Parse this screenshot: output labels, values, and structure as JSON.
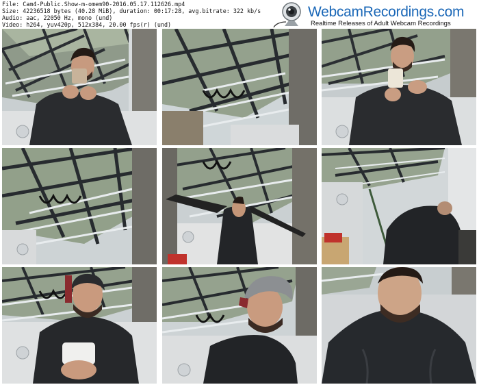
{
  "meta": {
    "line1": "File: Cam4-Public.Show-m-omem90-2016.05.17.112626.mp4",
    "line2": "Size: 42236518 bytes (40.28 MiB), duration: 00:17:28, avg.bitrate: 322 kb/s",
    "line3": "Audio: aac, 22050 Hz, mono (und)",
    "line4": "Video: h264, yuv420p, 512x384, 20.00 fps(r) (und)"
  },
  "brand": {
    "title": "WebcamRecordings.com",
    "tagline": "Realtime Releases of Adult Webcam Recordings",
    "title_color": "#1a67b7"
  },
  "thumbnails": [
    {
      "scene": "man looking at phone under glass roof",
      "timestamp": ""
    },
    {
      "scene": "glass roof with ceiling structure",
      "timestamp": ""
    },
    {
      "scene": "man holding phone, hand on chest",
      "timestamp": ""
    },
    {
      "scene": "glass roof with ceiling structure",
      "timestamp": ""
    },
    {
      "scene": "man stretching arms wide",
      "timestamp": ""
    },
    {
      "scene": "man bending over in room",
      "timestamp": ""
    },
    {
      "scene": "man in cap holding phone",
      "timestamp": ""
    },
    {
      "scene": "man in cap close-up",
      "timestamp": ""
    },
    {
      "scene": "man face close to camera",
      "timestamp": ""
    }
  ]
}
